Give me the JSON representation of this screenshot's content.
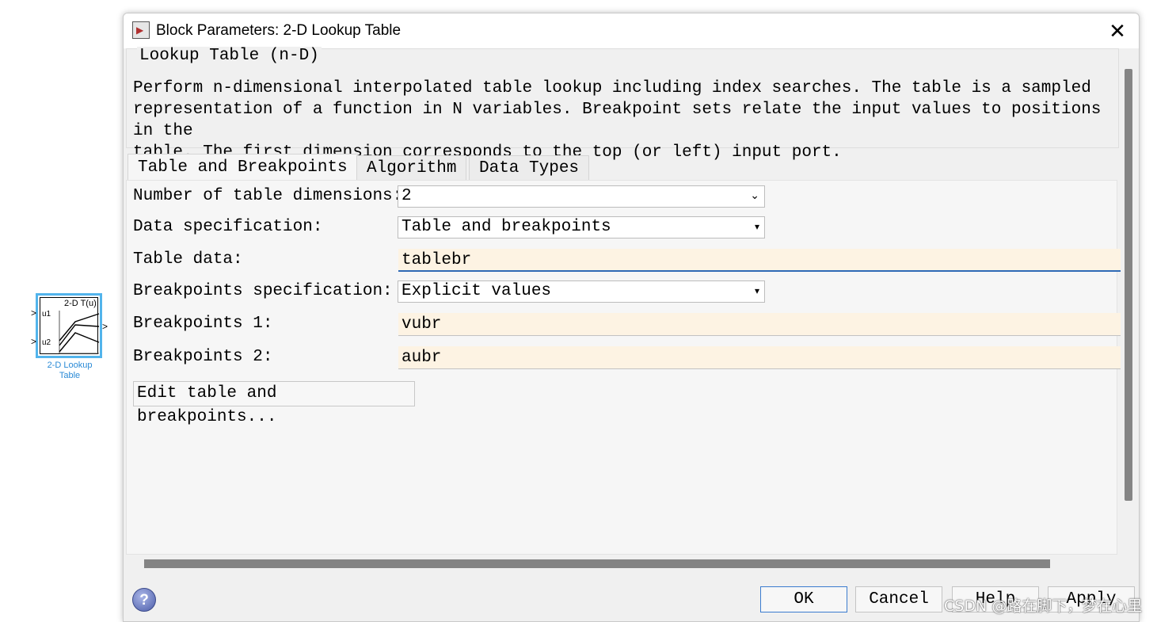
{
  "block": {
    "title": "2-D T(u)",
    "port1": "u1",
    "port2": "u2",
    "caption_line1": "2-D Lookup",
    "caption_line2": "Table"
  },
  "dialog": {
    "title": "Block Parameters: 2-D Lookup Table",
    "group_title": "Lookup Table (n-D)",
    "description": "Perform n-dimensional interpolated table lookup including index searches. The table is a sampled\nrepresentation of a function in N variables. Breakpoint sets relate the input values to positions in the\ntable. The first dimension corresponds to the top (or left) input port.",
    "tabs": [
      {
        "label": "Table and Breakpoints"
      },
      {
        "label": "Algorithm"
      },
      {
        "label": "Data Types"
      }
    ],
    "fields": {
      "num_dims_label": "Number of table dimensions:",
      "num_dims_value": "2",
      "data_spec_label": "Data specification:",
      "data_spec_value": "Table and breakpoints",
      "table_data_label": "Table data:",
      "table_data_value": "tablebr",
      "bp_spec_label": "Breakpoints specification:",
      "bp_spec_value": "Explicit values",
      "bp1_label": "Breakpoints 1:",
      "bp1_value": "vubr",
      "bp2_label": "Breakpoints 2:",
      "bp2_value": "aubr"
    },
    "edit_button": "Edit table and breakpoints...",
    "buttons": {
      "ok": "OK",
      "cancel": "Cancel",
      "help": "Help",
      "apply": "Apply"
    },
    "help_icon_glyph": "?",
    "close_glyph": "✕"
  },
  "watermark": "CSDN @路在脚下，梦在心里",
  "colors": {
    "accent_block": "#52b4ec",
    "field_bg": "#fdf3e3",
    "focus_border": "#2e6ab6"
  }
}
